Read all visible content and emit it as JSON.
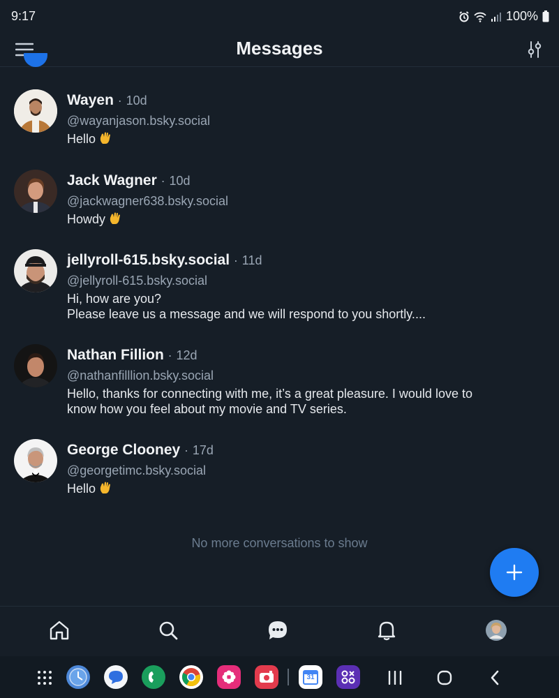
{
  "status_bar": {
    "time": "9:17",
    "battery": "100%"
  },
  "header": {
    "title": "Messages"
  },
  "conversations": [
    {
      "name": "Wayen",
      "ago": "10d",
      "handle": "@wayanjason.bsky.social",
      "preview": "Hello",
      "emoji": "waving-hand"
    },
    {
      "name": "Jack Wagner",
      "ago": "10d",
      "handle": "@jackwagner638.bsky.social",
      "preview": "Howdy",
      "emoji": "waving-hand"
    },
    {
      "name": "jellyroll-615.bsky.social",
      "ago": "11d",
      "handle": "@jellyroll-615.bsky.social",
      "preview_line1": "Hi, how are you?",
      "preview_line2": "Please leave us a message and we will respond to you shortly...."
    },
    {
      "name": "Nathan Fillion",
      "ago": "12d",
      "handle": "@nathanfilllion.bsky.social",
      "preview_line1": "Hello, thanks for connecting with me, it’s a great pleasure. I would love to",
      "preview_line2": "know how you feel about my movie and TV series."
    },
    {
      "name": "George Clooney",
      "ago": "17d",
      "handle": "@georgetimc.bsky.social",
      "preview": "Hello",
      "emoji": "waving-hand"
    }
  ],
  "separator": "·",
  "end_note": "No more conversations to show",
  "bottom_nav": [
    "home-icon",
    "search-icon",
    "chat-icon",
    "bell-icon",
    "profile-avatar"
  ],
  "dock": {
    "calendar_day": "31"
  },
  "colors": {
    "background": "#161e27",
    "accent": "#1f7cf2",
    "muted_text": "#9aa6b4"
  }
}
